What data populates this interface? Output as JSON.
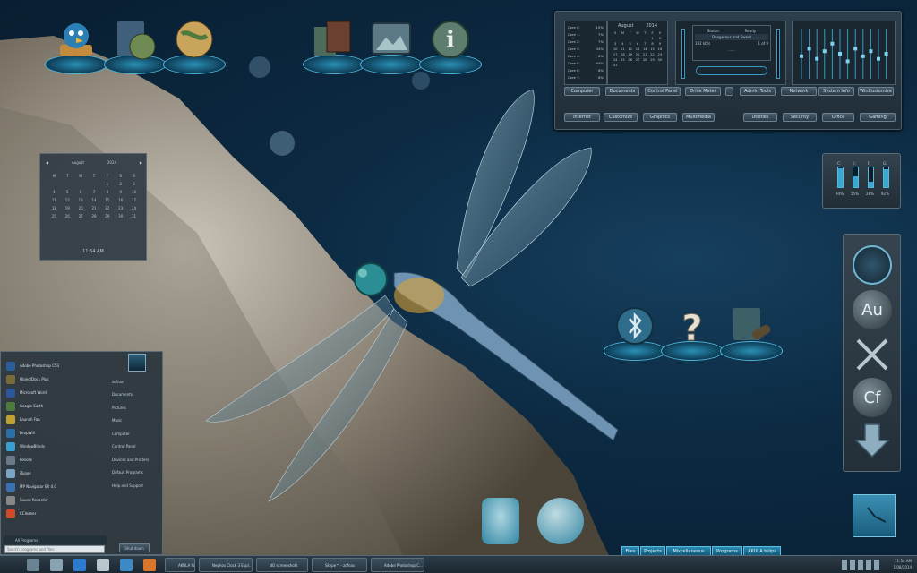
{
  "top_dock": {
    "icons": [
      "twitter-bird-icon",
      "book-globe-icon",
      "globe-icon",
      "books-icon",
      "photo-frame-icon",
      "info-icon"
    ]
  },
  "center_dock": {
    "icons": [
      "bluetooth-icon",
      "help-question-icon",
      "book-telescope-icon"
    ]
  },
  "control_panel": {
    "cores": [
      {
        "label": "Core 0:",
        "value": "15%"
      },
      {
        "label": "Core 1:",
        "value": "7%"
      },
      {
        "label": "Core 2:",
        "value": "7%"
      },
      {
        "label": "Core 3:",
        "value": "44%"
      },
      {
        "label": "Core 4:",
        "value": "8%"
      },
      {
        "label": "Core 5:",
        "value": "64%"
      },
      {
        "label": "Core 6:",
        "value": "8%"
      },
      {
        "label": "Core 7:",
        "value": "8%"
      }
    ],
    "calendar": {
      "month": "August",
      "year": "2014",
      "days_header": [
        "S",
        "M",
        "T",
        "W",
        "T",
        "F",
        "S"
      ],
      "days": [
        "",
        "",
        "",
        "",
        "",
        "1",
        "2",
        "3",
        "4",
        "5",
        "6",
        "7",
        "8",
        "9",
        "10",
        "11",
        "12",
        "13",
        "14",
        "15",
        "16",
        "17",
        "18",
        "19",
        "20",
        "21",
        "22",
        "23",
        "24",
        "25",
        "26",
        "27",
        "28",
        "29",
        "30",
        "31"
      ]
    },
    "player": {
      "status_label": "Status:",
      "status_value": "Ready",
      "track": "Dangerous and Sweet",
      "bitrate": "192 kb/s",
      "position": "1 of 9",
      "progress": "......"
    },
    "row1": [
      "Computer",
      "Documents",
      "Control Panel",
      "Drive Meter",
      "Admin Tools",
      "Network",
      "System Info",
      "WinCustomize"
    ],
    "row2": [
      "Internet",
      "Customize",
      "Graphics",
      "Multimedia",
      "Utilities",
      "Security",
      "Office",
      "Gaming"
    ],
    "eq_levels": [
      0.45,
      0.6,
      0.4,
      0.55,
      0.7,
      0.5,
      0.35,
      0.6,
      0.45,
      0.55,
      0.4,
      0.5
    ]
  },
  "cpu_meter": {
    "labels": [
      "C:",
      "E:",
      "F:",
      "G:"
    ],
    "values": [
      "94%",
      "55%",
      "28%",
      "92%"
    ],
    "fill": [
      0.94,
      0.55,
      0.28,
      0.92
    ]
  },
  "desk_calendar": {
    "prev": "◀",
    "month": "August",
    "year": "2014",
    "next": "▶",
    "days_header": [
      "M",
      "T",
      "W",
      "T",
      "F",
      "S",
      "S"
    ],
    "days": [
      "",
      "",
      "",
      "",
      "1",
      "2",
      "3",
      "4",
      "5",
      "6",
      "7",
      "8",
      "9",
      "10",
      "11",
      "12",
      "13",
      "14",
      "15",
      "16",
      "17",
      "18",
      "19",
      "20",
      "21",
      "22",
      "23",
      "24",
      "25",
      "26",
      "27",
      "28",
      "29",
      "30",
      "31"
    ],
    "time": "11:54 AM"
  },
  "start_menu": {
    "programs": [
      "Adobe Photoshop CS3",
      "ObjectDock Plus",
      "Microsoft Word",
      "Google Earth",
      "Launch Fan",
      "DropWill",
      "WindowBlinds",
      "Fences",
      "iTunes",
      "MP Navigator EX 4.0",
      "Sound Recorder",
      "CCleaner"
    ],
    "all_programs": "All Programs",
    "search_placeholder": "Search programs and files",
    "shutdown": "Shut down",
    "places": [
      "zofnas",
      "Documents",
      "Pictures",
      "Music",
      "Computer",
      "Control Panel",
      "Devices and Printers",
      "Default Programs",
      "Help and Support"
    ]
  },
  "bottom_tabs": [
    "Files",
    "Projects",
    "Miscellaneous",
    "Programs",
    "AKULA tulips"
  ],
  "taskbar": {
    "tasks": [
      "AKULA for WB - Rena...",
      "Nephos Clock 3 Expl...",
      "NO screenshots",
      "Skype™ - zofnas",
      "Adobe Photoshop C..."
    ],
    "clock_time": "11:54 AM",
    "clock_date": "1/08/2014"
  },
  "sidebar": {
    "icons": [
      "spiral-3d-icon",
      "audition-au-icon",
      "scissors-icon",
      "coldfusion-cf-icon",
      "down-arrow-icon"
    ],
    "labels": [
      "Au",
      "Cf"
    ]
  }
}
